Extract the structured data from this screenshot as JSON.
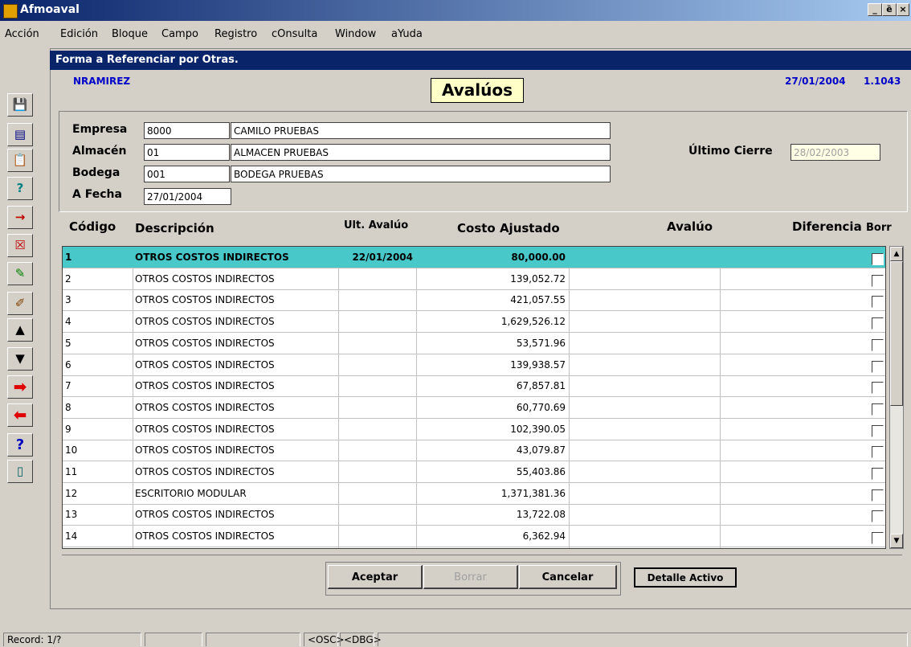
{
  "window": {
    "title": "Afmoaval",
    "min": "_",
    "max": "ȅ",
    "close": "×"
  },
  "menu": [
    "Acción",
    "Edición",
    "Bloque",
    "Campo",
    "Registro",
    "cOnsulta",
    "Window",
    "aYuda"
  ],
  "toolbar": {
    "icons": [
      "save-icon",
      "list-icon",
      "clipboard-icon",
      "query-icon",
      "insert-record-icon",
      "delete-record-icon",
      "eraser-icon",
      "edit-icon",
      "up-arrow-icon",
      "down-arrow-icon",
      "next-arrow-icon",
      "prev-arrow-icon",
      "help-icon",
      "exit-icon"
    ],
    "glyphs": [
      "💾",
      "▤",
      "📋",
      "?",
      "→",
      "☒",
      "✎",
      "✐",
      "▲",
      "▼",
      "➡",
      "⬅",
      "?",
      "▯"
    ]
  },
  "form": {
    "title": "Forma a Referenciar por Otras.",
    "user": "NRAMIREZ",
    "heading": "Avalúos",
    "date": "27/01/2004",
    "version": "1.1043"
  },
  "fields": {
    "empresa_label": "Empresa",
    "empresa_code": "8000",
    "empresa_name": "CAMILO PRUEBAS",
    "almacen_label": "Almacén",
    "almacen_code": "01",
    "almacen_name": "ALMACEN PRUEBAS",
    "bodega_label": "Bodega",
    "bodega_code": "001",
    "bodega_name": "BODEGA PRUEBAS",
    "fecha_label": "A Fecha",
    "fecha_value": "27/01/2004",
    "ultimo_cierre_label": "Último Cierre",
    "ultimo_cierre_value": "28/02/2003"
  },
  "table": {
    "headers": {
      "codigo": "Código",
      "descripcion": "Descripción",
      "ult_avaluo": "Ult. Avalúo",
      "costo": "Costo Ajustado",
      "avaluo": "Avalúo",
      "diferencia": "Diferencia",
      "borr": "Borr"
    },
    "rows": [
      {
        "codigo": "1",
        "descripcion": "OTROS COSTOS INDIRECTOS",
        "ult": "22/01/2004",
        "costo": "80,000.00"
      },
      {
        "codigo": "2",
        "descripcion": "OTROS COSTOS INDIRECTOS",
        "ult": "",
        "costo": "139,052.72"
      },
      {
        "codigo": "3",
        "descripcion": "OTROS COSTOS INDIRECTOS",
        "ult": "",
        "costo": "421,057.55"
      },
      {
        "codigo": "4",
        "descripcion": "OTROS COSTOS INDIRECTOS",
        "ult": "",
        "costo": "1,629,526.12"
      },
      {
        "codigo": "5",
        "descripcion": "OTROS COSTOS INDIRECTOS",
        "ult": "",
        "costo": "53,571.96"
      },
      {
        "codigo": "6",
        "descripcion": "OTROS COSTOS INDIRECTOS",
        "ult": "",
        "costo": "139,938.57"
      },
      {
        "codigo": "7",
        "descripcion": "OTROS COSTOS INDIRECTOS",
        "ult": "",
        "costo": "67,857.81"
      },
      {
        "codigo": "8",
        "descripcion": "OTROS COSTOS INDIRECTOS",
        "ult": "",
        "costo": "60,770.69"
      },
      {
        "codigo": "9",
        "descripcion": "OTROS COSTOS INDIRECTOS",
        "ult": "",
        "costo": "102,390.05"
      },
      {
        "codigo": "10",
        "descripcion": "OTROS COSTOS INDIRECTOS",
        "ult": "",
        "costo": "43,079.87"
      },
      {
        "codigo": "11",
        "descripcion": "OTROS COSTOS INDIRECTOS",
        "ult": "",
        "costo": "55,403.86"
      },
      {
        "codigo": "12",
        "descripcion": "ESCRITORIO MODULAR",
        "ult": "",
        "costo": "1,371,381.36"
      },
      {
        "codigo": "13",
        "descripcion": "OTROS COSTOS INDIRECTOS",
        "ult": "",
        "costo": "13,722.08"
      },
      {
        "codigo": "14",
        "descripcion": "OTROS COSTOS INDIRECTOS",
        "ult": "",
        "costo": "6,362.94"
      }
    ]
  },
  "buttons": {
    "aceptar": "Aceptar",
    "borrar": "Borrar",
    "cancelar": "Cancelar",
    "detalle": "Detalle Activo"
  },
  "status": {
    "record": "Record: 1/?",
    "osc": "<OSC>",
    "dbg": "<DBG>"
  },
  "colors": {
    "title_blue": "#0a246a",
    "selected_row": "#48c8c8",
    "info_blue": "#0000c8"
  }
}
